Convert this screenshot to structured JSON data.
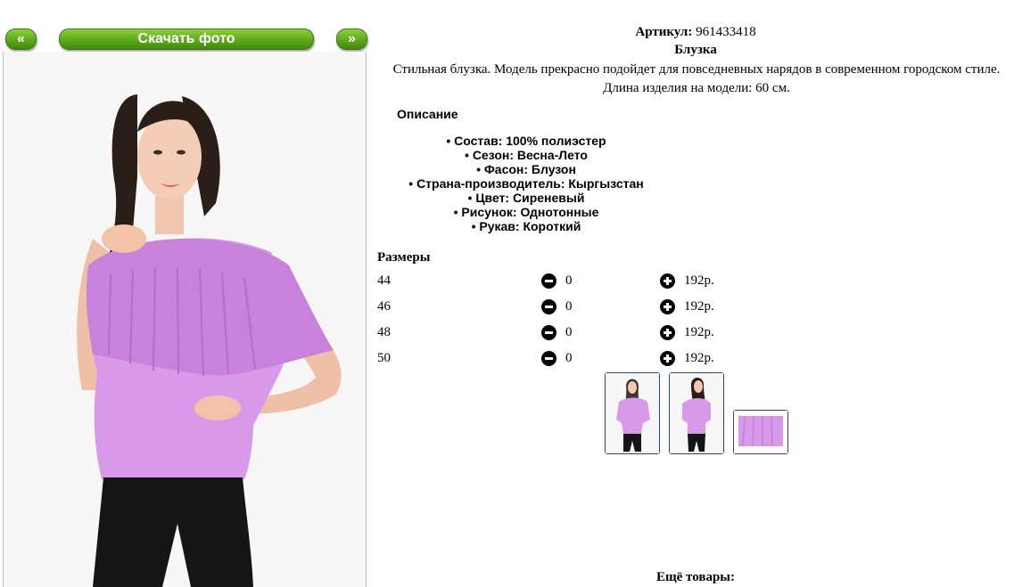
{
  "nav": {
    "prev_label": "«",
    "download_label": "Скачать фото",
    "next_label": "»"
  },
  "product": {
    "article_label": "Артикул:",
    "article_value": "961433418",
    "name": "Блузка",
    "description": "Стильная блузка. Модель прекрасно подойдет для повседневных нарядов в современном городском стиле. Длина изделия на модели: 60 см."
  },
  "details": {
    "heading": "Описание",
    "features": [
      "• Состав: 100% полиэстер",
      "• Сезон: Весна-Лето",
      "• Фасон: Блузон",
      "• Страна-производитель: Кыргызстан",
      "• Цвет: Сиреневый",
      "• Рисунок: Однотонные",
      "• Рукав: Короткий"
    ]
  },
  "sizes": {
    "heading": "Размеры",
    "rows": [
      {
        "size": "44",
        "qty": "0",
        "price": "192р."
      },
      {
        "size": "46",
        "qty": "0",
        "price": "192р."
      },
      {
        "size": "48",
        "qty": "0",
        "price": "192р."
      },
      {
        "size": "50",
        "qty": "0",
        "price": "192р."
      }
    ]
  },
  "more": {
    "heading": "Ещё товары:"
  },
  "colors": {
    "button_green": "#5ea81c",
    "blouse_lilac": "#d89ae8",
    "thumb_border": "#2a4a66"
  }
}
